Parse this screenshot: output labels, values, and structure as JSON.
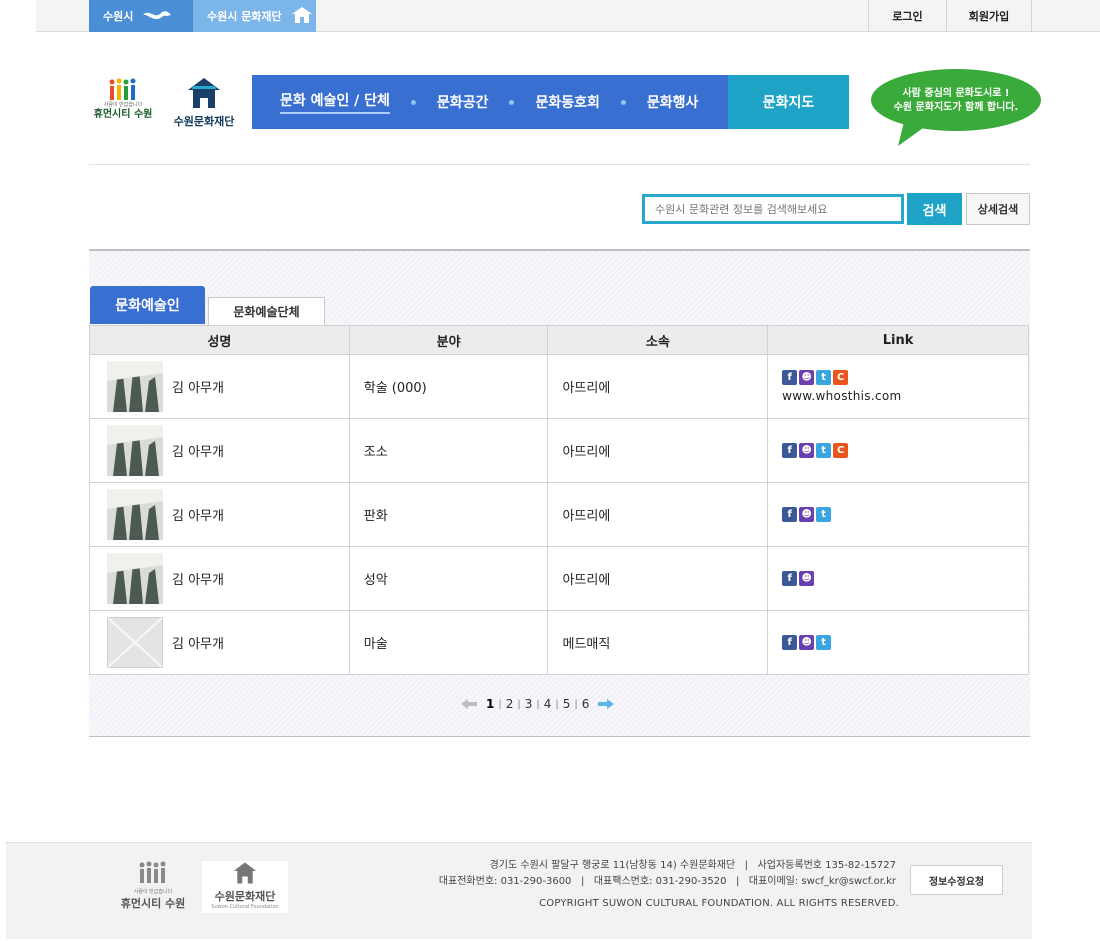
{
  "topbar": {
    "suwon_label": "수원시",
    "foundation_label": "수원시 문화재단",
    "login_label": "로그인",
    "join_label": "회원가입"
  },
  "header": {
    "humancity_slogan": "사람이 반갑습니다",
    "humancity_name": "휴먼시티 수원",
    "foundation_name": "수원문화재단",
    "nav": [
      {
        "label": "문화 예술인 / 단체"
      },
      {
        "label": "문화공간"
      },
      {
        "label": "문화동호회"
      },
      {
        "label": "문화행사"
      }
    ],
    "map_label": "문화지도",
    "bubble_line1": "사람 중심의 문화도시로 !",
    "bubble_line2": "수원 문화지도가 함께 합니다."
  },
  "search": {
    "placeholder": "수원시 문화관련 정보를 검색해보세요",
    "button_label": "검색",
    "advanced_label": "상세검색"
  },
  "tabs": {
    "artists": "문화예술인",
    "groups": "문화예술단체"
  },
  "table": {
    "headers": [
      "성명",
      "분야",
      "소속",
      "Link"
    ],
    "rows": [
      {
        "name": "김 아무개",
        "field": "학술 (000)",
        "affiliation": "아뜨리에",
        "url": "www.whosthis.com"
      },
      {
        "name": "김 아무개",
        "field": "조소",
        "affiliation": "아뜨리에"
      },
      {
        "name": "김 아무개",
        "field": "판화",
        "affiliation": "아뜨리에"
      },
      {
        "name": "김 아무개",
        "field": "성악",
        "affiliation": "아뜨리에"
      },
      {
        "name": "김 아무개",
        "field": "마술",
        "affiliation": "메드매직"
      }
    ]
  },
  "pagination": {
    "pages": [
      "1",
      "2",
      "3",
      "4",
      "5",
      "6"
    ],
    "current": "1",
    "separator": "|"
  },
  "footer": {
    "address": "경기도 수원시 팔달구 행궁로 11(남창동 14) 수원문화재단   |   사업자등록번호 135-82-15727",
    "contact": "대표전화번호: 031-290-3600   |   대표팩스번호: 031-290-3520   |   대표이메일: swcf_kr@swcf.or.kr",
    "copyright": "COPYRIGHT SUWON CULTURAL FOUNDATION. ALL RIGHTS RESERVED.",
    "update_button": "정보수정요청",
    "humancity_slogan": "사람이 반갑습니다",
    "humancity_name": "휴먼시티 수원",
    "foundation_name": "수원문화재단",
    "foundation_en": "Suwon Cultural Foundation"
  },
  "sns_letters": {
    "facebook": "f",
    "me2day": "☻",
    "twitter": "t",
    "cyworld": "C"
  },
  "colors": {
    "primary_blue": "#3a6fd2",
    "teal": "#1fa4c8",
    "bubble_green": "#3aab3a"
  }
}
